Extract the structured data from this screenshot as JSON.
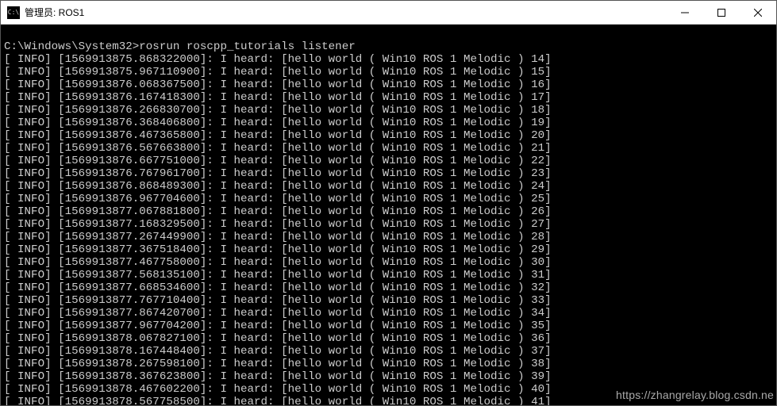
{
  "window": {
    "title": "管理员: ROS1"
  },
  "terminal": {
    "prompt": "C:\\Windows\\System32>",
    "command": "rosrun roscpp_tutorials listener",
    "blank_line": "",
    "log_prefix": "[ INFO] [",
    "log_mid1": "]: I heard: [hello world ( Win10 ROS 1 Melodic ) ",
    "log_suffix": "]",
    "entries": [
      {
        "ts": "1569913875.868322000",
        "n": "14"
      },
      {
        "ts": "1569913875.967110900",
        "n": "15"
      },
      {
        "ts": "1569913876.068367500",
        "n": "16"
      },
      {
        "ts": "1569913876.167418300",
        "n": "17"
      },
      {
        "ts": "1569913876.266830700",
        "n": "18"
      },
      {
        "ts": "1569913876.368406800",
        "n": "19"
      },
      {
        "ts": "1569913876.467365800",
        "n": "20"
      },
      {
        "ts": "1569913876.567663800",
        "n": "21"
      },
      {
        "ts": "1569913876.667751000",
        "n": "22"
      },
      {
        "ts": "1569913876.767961700",
        "n": "23"
      },
      {
        "ts": "1569913876.868489300",
        "n": "24"
      },
      {
        "ts": "1569913876.967704600",
        "n": "25"
      },
      {
        "ts": "1569913877.067881800",
        "n": "26"
      },
      {
        "ts": "1569913877.168329500",
        "n": "27"
      },
      {
        "ts": "1569913877.267449900",
        "n": "28"
      },
      {
        "ts": "1569913877.367518400",
        "n": "29"
      },
      {
        "ts": "1569913877.467758000",
        "n": "30"
      },
      {
        "ts": "1569913877.568135100",
        "n": "31"
      },
      {
        "ts": "1569913877.668534600",
        "n": "32"
      },
      {
        "ts": "1569913877.767710400",
        "n": "33"
      },
      {
        "ts": "1569913877.867420700",
        "n": "34"
      },
      {
        "ts": "1569913877.967704200",
        "n": "35"
      },
      {
        "ts": "1569913878.067827100",
        "n": "36"
      },
      {
        "ts": "1569913878.167448400",
        "n": "37"
      },
      {
        "ts": "1569913878.267598100",
        "n": "38"
      },
      {
        "ts": "1569913878.367623800",
        "n": "39"
      },
      {
        "ts": "1569913878.467602200",
        "n": "40"
      },
      {
        "ts": "1569913878.567758500",
        "n": "41"
      }
    ]
  },
  "watermark": "https://zhangrelay.blog.csdn.ne"
}
